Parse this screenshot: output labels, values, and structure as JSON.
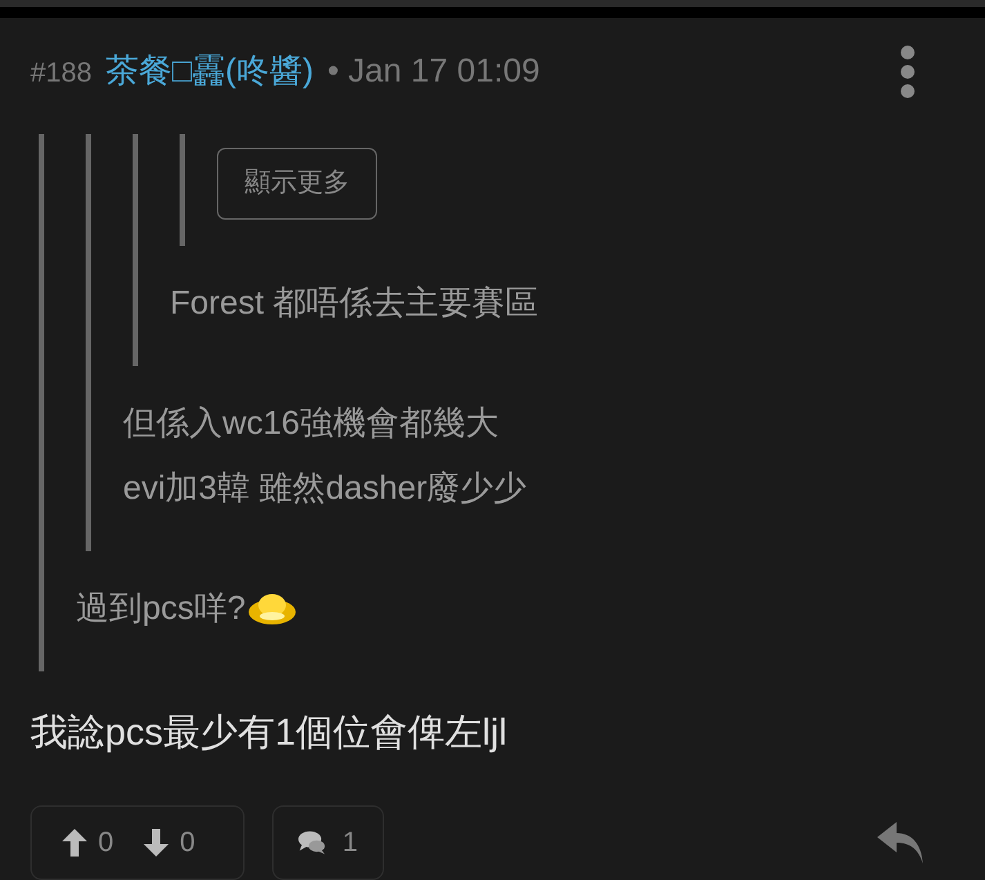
{
  "post": {
    "number": "#188",
    "author": "茶餐□靐(咚醬)",
    "time": "• Jan 17 01:09"
  },
  "quote": {
    "lines": [
      "過到pcs咩?"
    ],
    "emoji": true,
    "children": [
      {
        "lines": [
          "但係入wc16強機會都幾大",
          "evi加3韓 雖然dasher廢少少"
        ],
        "children": [
          {
            "lines": [
              "Forest 都唔係去主要賽區"
            ],
            "children": [
              {
                "kind": "more",
                "label": "顯示更多"
              }
            ]
          }
        ]
      }
    ]
  },
  "body": "我諗pcs最少有1個位會俾左ljl",
  "actions": {
    "upvotes": "0",
    "downvotes": "0",
    "replies": "1"
  }
}
